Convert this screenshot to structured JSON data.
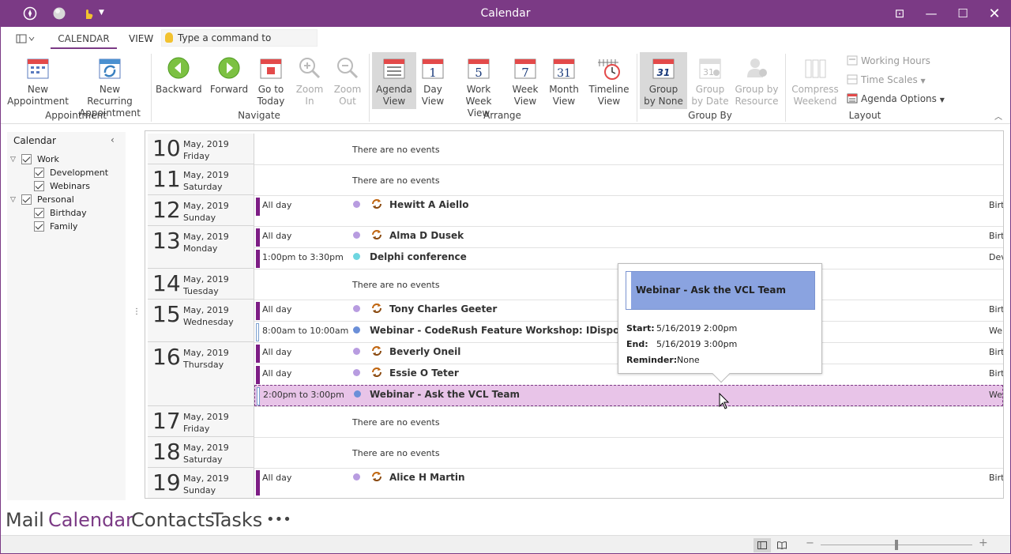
{
  "window": {
    "title": "Calendar"
  },
  "tabs": {
    "calendar": "CALENDAR",
    "view": "VIEW"
  },
  "command": {
    "placeholder": "Type a command to execute..."
  },
  "ribbon": {
    "appointment": {
      "group": "Appointment",
      "new_appointment": [
        "New",
        "Appointment"
      ],
      "new_recurring": [
        "New Recurring",
        "Appointment"
      ]
    },
    "navigate": {
      "group": "Navigate",
      "backward": "Backward",
      "forward": "Forward",
      "go_to_today": [
        "Go to",
        "Today"
      ],
      "zoom_in": [
        "Zoom",
        "In"
      ],
      "zoom_out": [
        "Zoom",
        "Out"
      ]
    },
    "arrange": {
      "group": "Arrange",
      "agenda": [
        "Agenda",
        "View"
      ],
      "day": [
        "Day",
        "View"
      ],
      "work_week": [
        "Work",
        "Week View"
      ],
      "week": [
        "Week",
        "View"
      ],
      "month": [
        "Month",
        "View"
      ],
      "timeline": [
        "Timeline",
        "View"
      ],
      "icon_day": "1",
      "icon_work": "5",
      "icon_week": "7",
      "icon_month": "31"
    },
    "groupby": {
      "group": "Group By",
      "none": [
        "Group",
        "by None"
      ],
      "date": [
        "Group",
        "by Date"
      ],
      "resource": [
        "Group by",
        "Resource"
      ],
      "icon_num": "31"
    },
    "layout": {
      "group": "Layout",
      "compress": [
        "Compress",
        "Weekend"
      ],
      "working_hours": "Working Hours",
      "time_scales": "Time Scales",
      "agenda_options": "Agenda Options"
    }
  },
  "sidebar": {
    "title": "Calendar",
    "tree": [
      "Work",
      "Development",
      "Webinars",
      "Personal",
      "Birthday",
      "Family"
    ]
  },
  "agenda": {
    "no_events": "There are no events",
    "days": [
      {
        "num": "10",
        "monthyear": "May, 2019",
        "weekday": "Friday"
      },
      {
        "num": "11",
        "monthyear": "May, 2019",
        "weekday": "Saturday"
      },
      {
        "num": "12",
        "monthyear": "May, 2019",
        "weekday": "Sunday"
      },
      {
        "num": "13",
        "monthyear": "May, 2019",
        "weekday": "Monday"
      },
      {
        "num": "14",
        "monthyear": "May, 2019",
        "weekday": "Tuesday"
      },
      {
        "num": "15",
        "monthyear": "May, 2019",
        "weekday": "Wednesday"
      },
      {
        "num": "16",
        "monthyear": "May, 2019",
        "weekday": "Thursday"
      },
      {
        "num": "17",
        "monthyear": "May, 2019",
        "weekday": "Friday"
      },
      {
        "num": "18",
        "monthyear": "May, 2019",
        "weekday": "Saturday"
      },
      {
        "num": "19",
        "monthyear": "May, 2019",
        "weekday": "Sunday"
      }
    ],
    "events": [
      {
        "time": "All day",
        "subject": "Hewitt A Aiello",
        "category": "Birthday"
      },
      {
        "time": "All day",
        "subject": "Alma D Dusek",
        "category": "Birthday"
      },
      {
        "time": "1:00pm to 3:30pm",
        "subject": "Delphi conference",
        "category": "Development"
      },
      {
        "time": "All day",
        "subject": "Tony Charles Geeter",
        "category": "Birthday"
      },
      {
        "time": "8:00am to 10:00am",
        "subject": "Webinar - CodeRush Feature Workshop: IDisposable",
        "category": "Webinars"
      },
      {
        "time": "All day",
        "subject": "Beverly Oneil",
        "category": "Birthday"
      },
      {
        "time": "All day",
        "subject": "Essie O Teter",
        "category": "Birthday"
      },
      {
        "time": "2:00pm to 3:00pm",
        "subject": "Webinar - Ask the VCL Team",
        "category": "Webinars"
      },
      {
        "time": "All day",
        "subject": "Alice H Martin",
        "category": "Birthday"
      }
    ]
  },
  "popup": {
    "subject": "Webinar - Ask the VCL Team",
    "start_label": "Start:",
    "start": "5/16/2019  2:00pm",
    "end_label": "End:",
    "end": "5/16/2019  3:00pm",
    "reminder_label": "Reminder:",
    "reminder": "None"
  },
  "nav": {
    "mail": "Mail",
    "calendar": "Calendar",
    "contacts": "Contacts",
    "tasks": "Tasks",
    "more": "•••"
  },
  "colors": {
    "accent": "#7b3a85",
    "birthday_dot": "#b89ce0",
    "development_dot": "#6ed6e0",
    "webinars_dot": "#6b8fd8",
    "selected_row": "#e8c4e8",
    "popup_header": "#8aa3e0"
  }
}
